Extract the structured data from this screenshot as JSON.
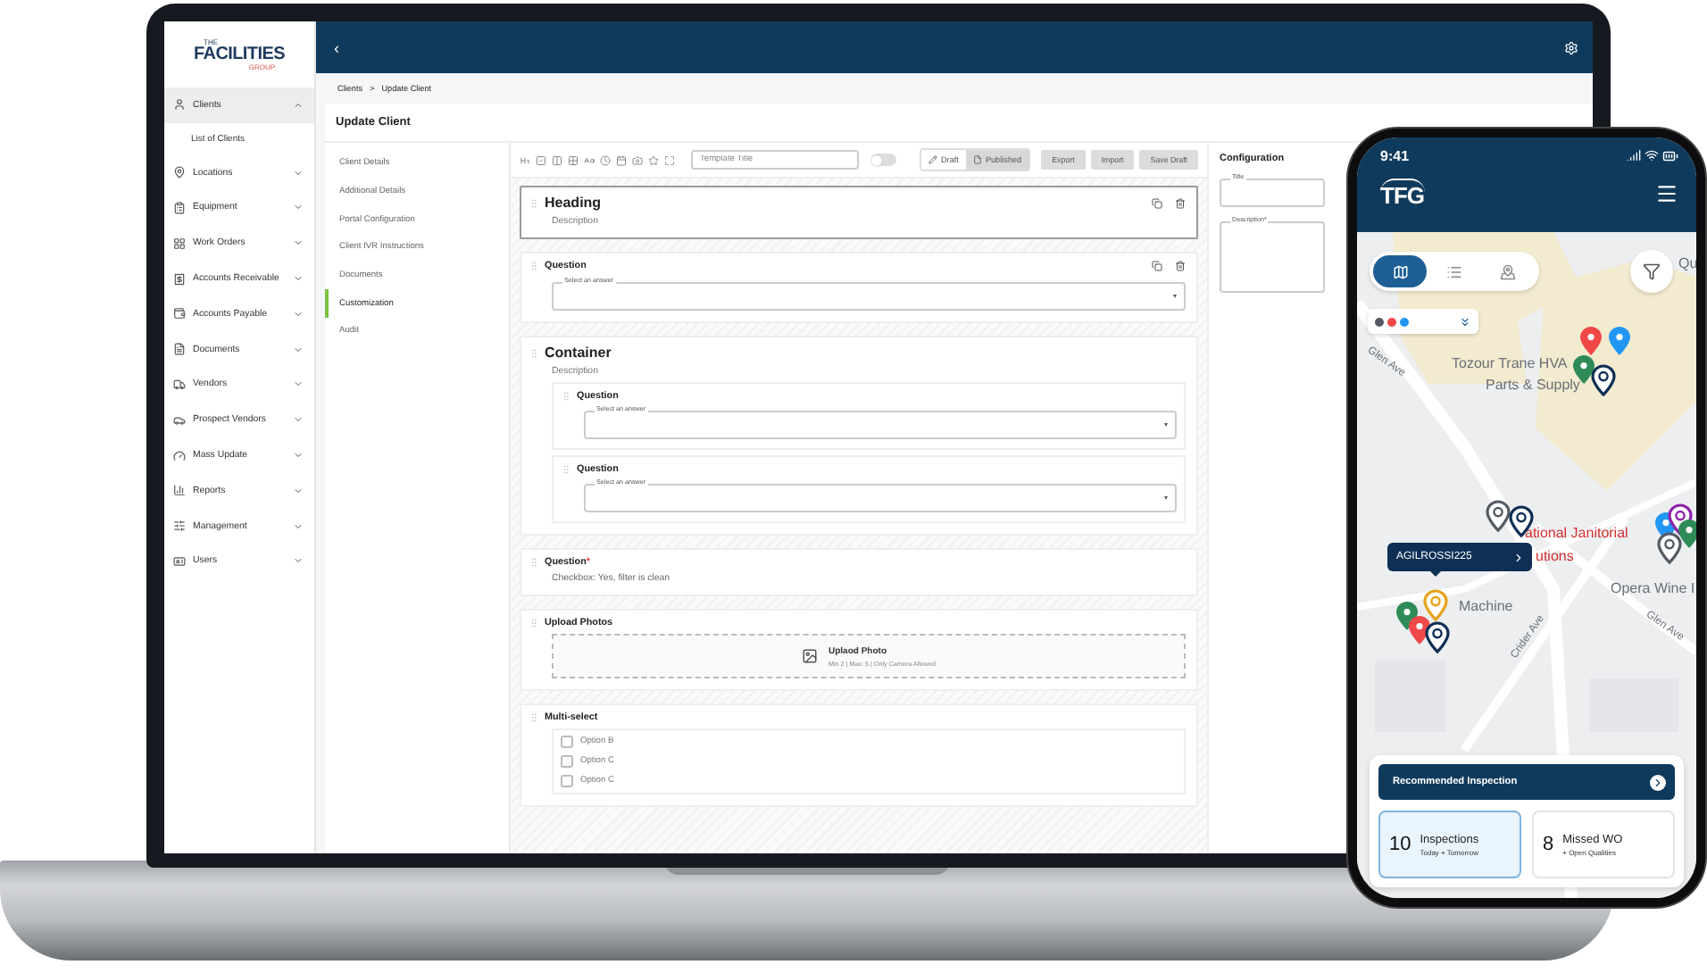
{
  "laptop": {
    "logo": {
      "top": "THE",
      "main": "FACILITIES",
      "bottom": "GROUP"
    },
    "sidebar": {
      "items": [
        {
          "label": "Clients",
          "expanded": true,
          "children": [
            {
              "label": "List of Clients"
            }
          ]
        },
        {
          "label": "Locations",
          "expanded": false
        },
        {
          "label": "Equipment",
          "expanded": false
        },
        {
          "label": "Work Orders",
          "expanded": false
        },
        {
          "label": "Accounts Receivable",
          "expanded": false
        },
        {
          "label": "Accounts Payable",
          "expanded": false
        },
        {
          "label": "Documents",
          "expanded": false
        },
        {
          "label": "Vendors",
          "expanded": false
        },
        {
          "label": "Prospect Vendors",
          "expanded": false
        },
        {
          "label": "Mass Update",
          "expanded": false
        },
        {
          "label": "Reports",
          "expanded": false
        },
        {
          "label": "Management",
          "expanded": false
        },
        {
          "label": "Users",
          "expanded": false
        }
      ]
    },
    "topbar": {
      "back": "‹"
    },
    "breadcrumb": [
      {
        "label": "Clients"
      },
      {
        "label": "Update Client"
      }
    ],
    "breadcrumb_separator": ">",
    "page_title": "Update Client",
    "subnav": [
      {
        "label": "Client Details",
        "selected": false
      },
      {
        "label": "Additional Details",
        "selected": false
      },
      {
        "label": "Portal Configuration",
        "selected": false
      },
      {
        "label": "Client IVR Instructions",
        "selected": false
      },
      {
        "label": "Documents",
        "selected": false
      },
      {
        "label": "Customization",
        "selected": true
      },
      {
        "label": "Audit",
        "selected": false
      }
    ],
    "toolbar": {
      "template_title": {
        "placeholder": "Template Title"
      },
      "toggle_on": false,
      "modes": [
        {
          "label": "Draft",
          "selected": false
        },
        {
          "label": "Published",
          "selected": true
        }
      ],
      "buttons": [
        "Export",
        "Import",
        "Save Draft"
      ]
    },
    "blocks": [
      {
        "kind": "heading",
        "title": "Heading",
        "description": "Description",
        "selected": true
      },
      {
        "kind": "question",
        "title": "Question",
        "select_label": "Select an answer"
      },
      {
        "kind": "container",
        "title": "Container",
        "description": "Description",
        "children": [
          {
            "kind": "question",
            "title": "Question",
            "select_label": "Select an answer"
          },
          {
            "kind": "question",
            "title": "Question",
            "select_label": "Select an answer"
          }
        ]
      },
      {
        "kind": "answer",
        "title": "Question",
        "required_mark": "*",
        "answer": "Checkbox: Yes, filter is clean"
      },
      {
        "kind": "upload",
        "title": "Upload Photos",
        "button": "Uplaod Photo",
        "hint": "Min 2 | Max: 5 | Only Camera Allowed"
      },
      {
        "kind": "multiselect",
        "title": "Multi-select",
        "options": [
          {
            "label": "Option B",
            "checked": false
          },
          {
            "label": "Option C",
            "checked": false
          },
          {
            "label": "Option C",
            "checked": false
          }
        ]
      }
    ],
    "configuration": {
      "title": "Configuration",
      "fields": [
        {
          "label": "Title",
          "kind": "line"
        },
        {
          "label": "Description*",
          "kind": "area"
        }
      ]
    }
  },
  "phone": {
    "time": "9:41",
    "logo": "TFG",
    "view_tabs": [
      {
        "selected": true
      },
      {
        "selected": false
      },
      {
        "selected": false
      }
    ],
    "legend": [
      {
        "color": "#555b63"
      },
      {
        "color": "#f04848"
      },
      {
        "color": "#2196f3"
      }
    ],
    "map_labels": [
      {
        "text": "Tozour Trane HVA",
        "kind": "place"
      },
      {
        "text": "Parts & Supply",
        "kind": "place"
      },
      {
        "text": "ational Janitorial",
        "kind": "business"
      },
      {
        "text": "utions",
        "kind": "business"
      },
      {
        "text": "Machine",
        "kind": "place"
      },
      {
        "text": "Opera Wine I",
        "kind": "place"
      },
      {
        "text": "Glen Ave",
        "kind": "street"
      },
      {
        "text": "Crider Ave",
        "kind": "street"
      },
      {
        "text": "Glen Ave",
        "kind": "street"
      },
      {
        "text": "Qu",
        "kind": "place"
      }
    ],
    "pins": [
      {
        "kind": "filled",
        "color": "#f04848"
      },
      {
        "kind": "filled",
        "color": "#2196f3"
      },
      {
        "kind": "filled",
        "color": "#2e8b57"
      },
      {
        "kind": "outline",
        "color": "#0f2f55"
      },
      {
        "kind": "outline",
        "color": "#555b63"
      },
      {
        "kind": "outline",
        "color": "#0f2f55"
      },
      {
        "kind": "filled",
        "color": "#2196f3"
      },
      {
        "kind": "outline",
        "color": "#8e24aa"
      },
      {
        "kind": "filled",
        "color": "#2e8b57"
      },
      {
        "kind": "outline",
        "color": "#555b63"
      },
      {
        "kind": "outline",
        "color": "#e6a21a"
      },
      {
        "kind": "filled",
        "color": "#2e8b57"
      },
      {
        "kind": "filled",
        "color": "#f04848"
      },
      {
        "kind": "outline",
        "color": "#0f2f55"
      }
    ],
    "callout": "AGILROSSI225",
    "recommended": "Recommended Inspection",
    "stats": [
      {
        "count": "10",
        "title": "Inspections",
        "subtitle": "Today + Tomorrow",
        "selected": true
      },
      {
        "count": "8",
        "title": "Missed WO",
        "subtitle": "+ Open Qualities",
        "selected": false
      }
    ]
  }
}
